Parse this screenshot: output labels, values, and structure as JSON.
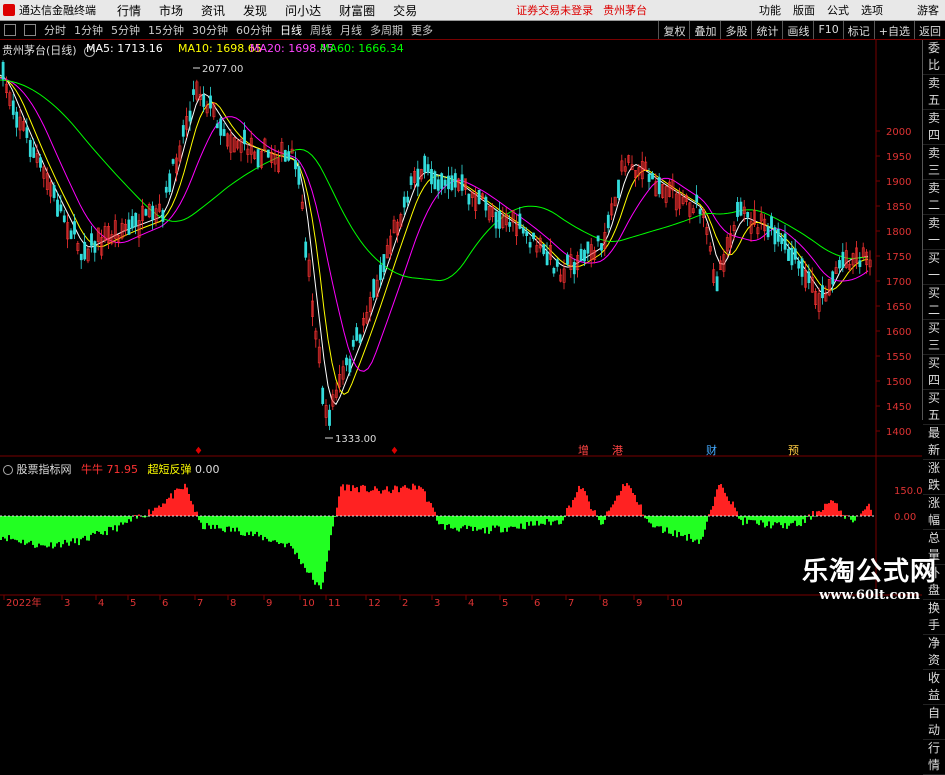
{
  "menubar": {
    "app_title": "通达信金融终端",
    "items": [
      "行情",
      "市场",
      "资讯",
      "发现",
      "问小达",
      "财富圈",
      "交易"
    ],
    "login_notice": "证券交易未登录",
    "stock_label": "贵州茅台",
    "right_items": [
      "功能",
      "版面",
      "公式",
      "选项",
      "游客"
    ]
  },
  "toolbar": {
    "periods": [
      "分时",
      "1分钟",
      "5分钟",
      "15分钟",
      "30分钟",
      "60分钟",
      "日线",
      "周线",
      "月线",
      "多周期",
      "更多"
    ],
    "active": "日线",
    "right_buttons": [
      "复权",
      "叠加",
      "多股",
      "统计",
      "画线",
      "F10",
      "标记",
      "+自选",
      "返回"
    ]
  },
  "main_chart": {
    "title": "贵州茅台(日线)",
    "ma5": "MA5: 1713.16",
    "ma10": "MA10: 1698.65",
    "ma20": "MA20: 1698.45",
    "ma60": "MA60: 1666.34",
    "high_label": "2077.00",
    "low_label": "1333.00",
    "y_ticks": [
      "2000",
      "1950",
      "1900",
      "1850",
      "1800",
      "1750",
      "1700",
      "1650",
      "1600",
      "1550",
      "1500",
      "1450",
      "1400"
    ],
    "ma_colors": {
      "ma5": "#ffffff",
      "ma10": "#ffff00",
      "ma20": "#ff00ff",
      "ma60": "#00ff00"
    }
  },
  "side_panel": [
    "委比",
    "卖五",
    "卖四",
    "卖三",
    "卖二",
    "卖一",
    "买一",
    "买二",
    "买三",
    "买四",
    "买五",
    "最新",
    "涨跌",
    "涨幅",
    "总量",
    "外盘",
    "换手",
    "净资",
    "收益",
    "自动",
    "行情"
  ],
  "event_markers": [
    "增",
    "港",
    "财",
    "预"
  ],
  "indicator": {
    "name": "股票指标网",
    "bull_label": "牛牛",
    "bull_value": "71.95",
    "extra_label": "超短反弹",
    "extra_value": "0.00",
    "y_ticks": [
      "150.0",
      "0.00"
    ]
  },
  "x_axis": [
    "2022年",
    "3",
    "4",
    "5",
    "6",
    "7",
    "8",
    "9",
    "10",
    "11",
    "12",
    "2",
    "3",
    "4",
    "5",
    "6",
    "7",
    "8",
    "9",
    "10"
  ],
  "watermark": {
    "cn": "乐淘公式网",
    "url": "www.60lt.com"
  }
}
